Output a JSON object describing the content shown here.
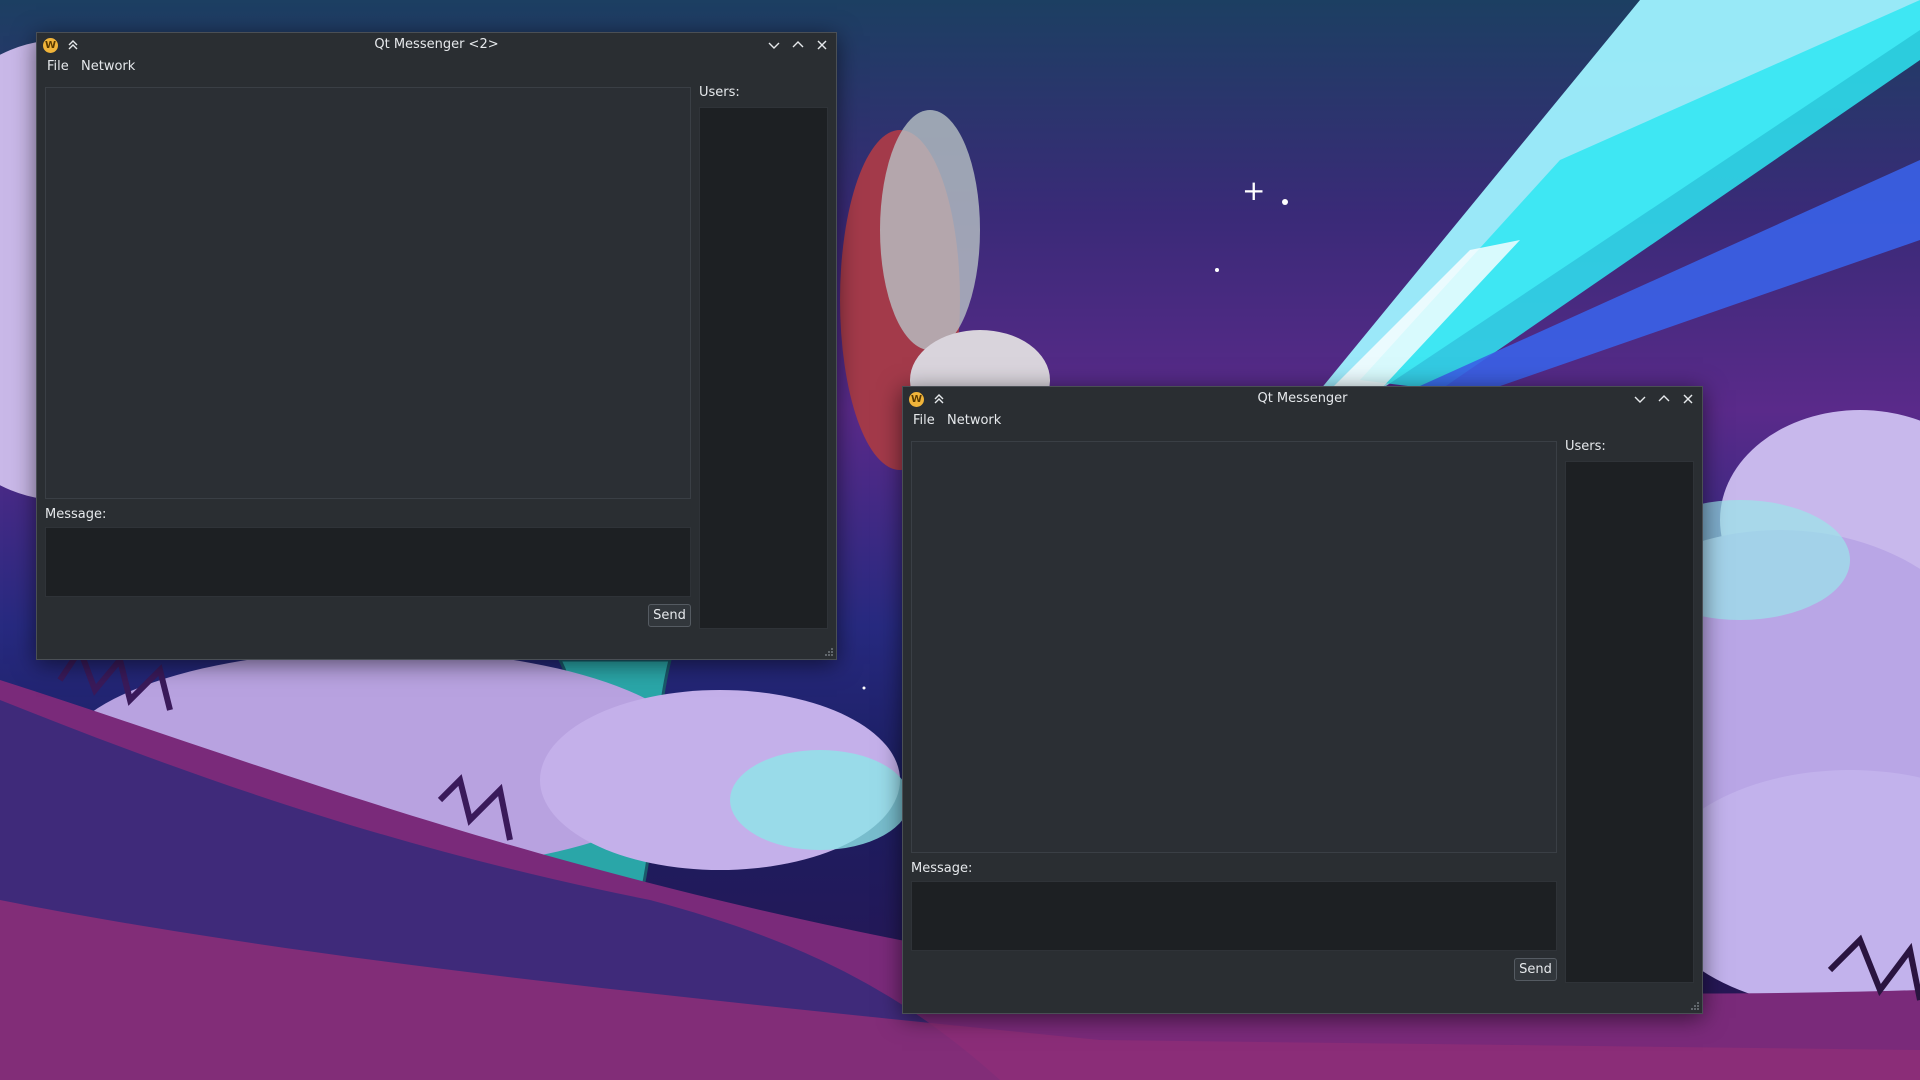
{
  "desktop": {
    "wallpaper": "painted night landscape with clouds, comet, tree and grassy hill"
  },
  "windows": [
    {
      "title": "Qt Messenger <2>",
      "app_icon": "W",
      "menu": {
        "file": "File",
        "network": "Network"
      },
      "message_label": "Message:",
      "users_label": "Users:",
      "send_label": "Send"
    },
    {
      "title": "Qt Messenger",
      "app_icon": "W",
      "menu": {
        "file": "File",
        "network": "Network"
      },
      "message_label": "Message:",
      "users_label": "Users:",
      "send_label": "Send"
    }
  ],
  "colors": {
    "window_bg": "#2a2e32",
    "input_bg": "#1d2023",
    "text": "#e6e9ec",
    "app_icon": "#f0b43a"
  }
}
